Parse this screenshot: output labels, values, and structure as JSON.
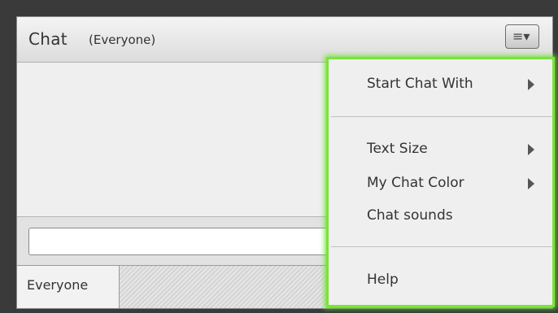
{
  "chat_pod": {
    "title": "Chat",
    "subtitle": "(Everyone)",
    "menu_button_icon": "hamburger-menu-icon",
    "input_value": "",
    "tab_label": "Everyone"
  },
  "menu": {
    "items": [
      {
        "label": "Start Chat With",
        "has_submenu": true
      },
      {
        "label": "Text Size",
        "has_submenu": true
      },
      {
        "label": "My Chat Color",
        "has_submenu": true
      },
      {
        "label": "Chat sounds",
        "has_submenu": false
      },
      {
        "label": "Help",
        "has_submenu": false
      }
    ]
  },
  "colors": {
    "menu_highlight": "#7ce33a",
    "background": "#3a3a3a"
  }
}
